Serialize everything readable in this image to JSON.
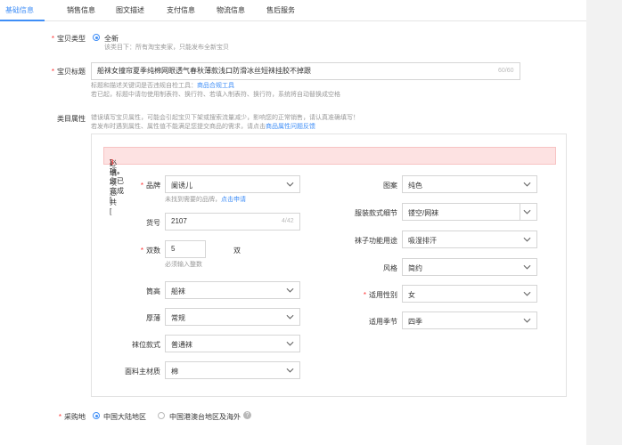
{
  "tabs": [
    "基础信息",
    "销售信息",
    "图文描述",
    "支付信息",
    "物流信息",
    "售后服务"
  ],
  "item_type": {
    "label": "宝贝类型",
    "option": "全新",
    "hint": "该类目下：所有淘宝卖家，只能发布全新宝贝"
  },
  "item_title": {
    "label": "宝贝标题",
    "value": "船袜女撞帘夏季纯棉网眼透气春秋薄款浅口防滑冰丝短袜挂胶不掉跟",
    "counter": "60/60",
    "hint1_prefix": "标题和描述关键词是否违规自检工具：",
    "hint1_link": "商品合规工具",
    "hint2": "若已起，标题中请勿使用制表符、换行符、若填入制表符、换行符，系统将自动替换成空格"
  },
  "category_attr": {
    "label": "类目属性",
    "hint1": "错误填写宝贝属性，可能会引起宝贝下架或搜索流量减少，影响您的正常销售，请认真准确填写！",
    "hint2_prefix": "若发布时遇到属性、属性值不能满足您提交商品的需求，请点击",
    "hint2_link": "商品属性问题反馈",
    "alert_prefix": "必填项总共 [",
    "alert_total": "3",
    "alert_mid": "] 项，您已完成 [",
    "alert_done": "3",
    "alert_suffix": "] 项。"
  },
  "left_fields": {
    "brand": {
      "label": "品牌",
      "value": "阑诱儿",
      "hint_prefix": "未找到需要的品牌，",
      "hint_link": "点击申请"
    },
    "model": {
      "label": "货号",
      "value": "2107",
      "counter": "4/42"
    },
    "pairs": {
      "label": "双数",
      "value": "5",
      "unit": "双",
      "hint": "必须输入整数"
    },
    "height": {
      "label": "筒高",
      "value": "船袜"
    },
    "thickness": {
      "label": "厚薄",
      "value": "常规"
    },
    "toe": {
      "label": "袜位款式",
      "value": "普通袜"
    },
    "material": {
      "label": "面料主材质",
      "value": "棉"
    }
  },
  "right_fields": {
    "pattern": {
      "label": "图案",
      "value": "纯色"
    },
    "detail": {
      "label": "服装款式细节",
      "value": "镂空/网袜"
    },
    "function": {
      "label": "袜子功能用途",
      "value": "吸湿排汗"
    },
    "style": {
      "label": "风格",
      "value": "简约"
    },
    "gender": {
      "label": "适用性别",
      "value": "女"
    },
    "season": {
      "label": "适用季节",
      "value": "四季"
    }
  },
  "origin": {
    "label": "采购地",
    "option1": "中国大陆地区",
    "option2": "中国港澳台地区及海外",
    "help": "?"
  },
  "colors": {
    "accent": "#3f8ef7",
    "required": "#f33",
    "alert_bg": "#fde2e2"
  }
}
